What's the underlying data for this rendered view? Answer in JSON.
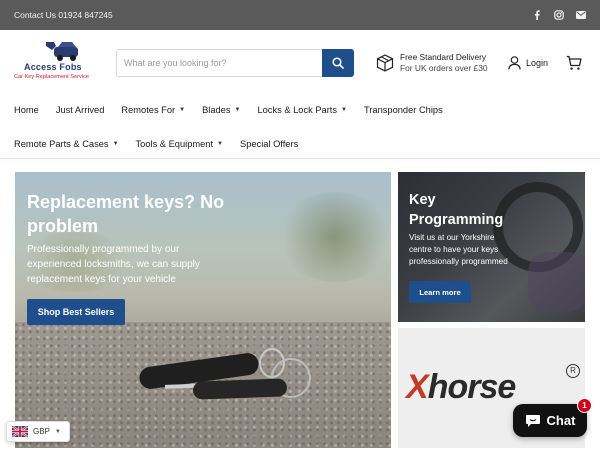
{
  "topbar": {
    "contact": "Contact Us 01924 847245",
    "social": [
      {
        "icon": "facebook-icon",
        "glyph": "f"
      },
      {
        "icon": "instagram-icon",
        "glyph": "◎"
      },
      {
        "icon": "email-icon",
        "glyph": "✉"
      }
    ]
  },
  "header": {
    "logo_name": "Access Fobs",
    "logo_tagline": "Car Key Replacement Service",
    "search_placeholder": "What are you looking for?",
    "delivery_title": "Free Standard Delivery",
    "delivery_subtitle": "For UK orders over £30",
    "login_label": "Login"
  },
  "nav": {
    "row1": [
      {
        "label": "Home",
        "dropdown": false
      },
      {
        "label": "Just Arrived",
        "dropdown": false
      },
      {
        "label": "Remotes For",
        "dropdown": true
      },
      {
        "label": "Blades",
        "dropdown": true
      },
      {
        "label": "Locks & Lock Parts",
        "dropdown": true
      },
      {
        "label": "Transponder Chips",
        "dropdown": false
      }
    ],
    "row2": [
      {
        "label": "Remote Parts & Cases",
        "dropdown": true
      },
      {
        "label": "Tools & Equipment",
        "dropdown": true
      },
      {
        "label": "Special Offers",
        "dropdown": false
      }
    ]
  },
  "hero": {
    "title": "Replacement keys? No problem",
    "text": "Professionally programmed by our experienced locksmiths, we can supply replacement keys for your vehicle",
    "cta": "Shop Best Sellers"
  },
  "promo_key": {
    "title": "Key Programming",
    "text": "Visit us at our Yorkshire centre to have your keys professionally programmed",
    "cta": "Learn more"
  },
  "promo_brand": {
    "brand": "horse",
    "brand_initial": "X",
    "registered": "R"
  },
  "currency": {
    "code": "GBP"
  },
  "chat": {
    "label": "Chat",
    "unread": "1"
  },
  "colors": {
    "accent": "#1e4f8c",
    "topbar": "#5a5a5a",
    "chat": "#111111",
    "badge": "#d0021b"
  }
}
